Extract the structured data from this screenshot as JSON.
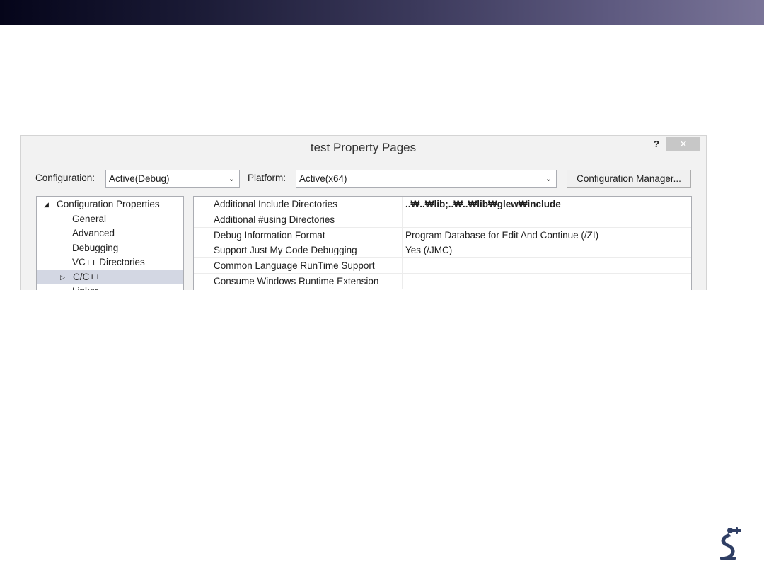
{
  "dialog": {
    "title": "test Property Pages",
    "help_label": "?",
    "close_label": "✕"
  },
  "toolbar": {
    "configuration_label": "Configuration:",
    "configuration_value": "Active(Debug)",
    "platform_label": "Platform:",
    "platform_value": "Active(x64)",
    "config_manager_label": "Configuration Manager...",
    "dropdown_arrow": "⌄"
  },
  "tree": {
    "items": [
      {
        "label": "Configuration Properties",
        "expander": "◢",
        "selected": false
      },
      {
        "label": "General",
        "expander": "",
        "selected": false
      },
      {
        "label": "Advanced",
        "expander": "",
        "selected": false
      },
      {
        "label": "Debugging",
        "expander": "",
        "selected": false
      },
      {
        "label": "VC++ Directories",
        "expander": "",
        "selected": false
      },
      {
        "label": "C/C++",
        "expander": "▷",
        "selected": true
      },
      {
        "label": "Linker",
        "expander": "▸",
        "selected": false
      }
    ]
  },
  "properties": {
    "rows": [
      {
        "name": "Additional Include Directories",
        "value": "..₩..₩lib;..₩..₩lib₩glew₩include"
      },
      {
        "name": "Additional #using Directories",
        "value": ""
      },
      {
        "name": "Debug Information Format",
        "value": "Program Database for Edit And Continue (/ZI)"
      },
      {
        "name": "Support Just My Code Debugging",
        "value": "Yes (/JMC)"
      },
      {
        "name": "Common Language RunTime Support",
        "value": ""
      },
      {
        "name": "Consume Windows Runtime Extension",
        "value": ""
      }
    ]
  },
  "colors": {
    "top_bar_start": "#05051a",
    "top_bar_end": "#7a7598",
    "selection": "#d3d7e3",
    "logo": "#2f3e64"
  },
  "icons": {
    "logo": "robot-arm-logo-icon"
  }
}
